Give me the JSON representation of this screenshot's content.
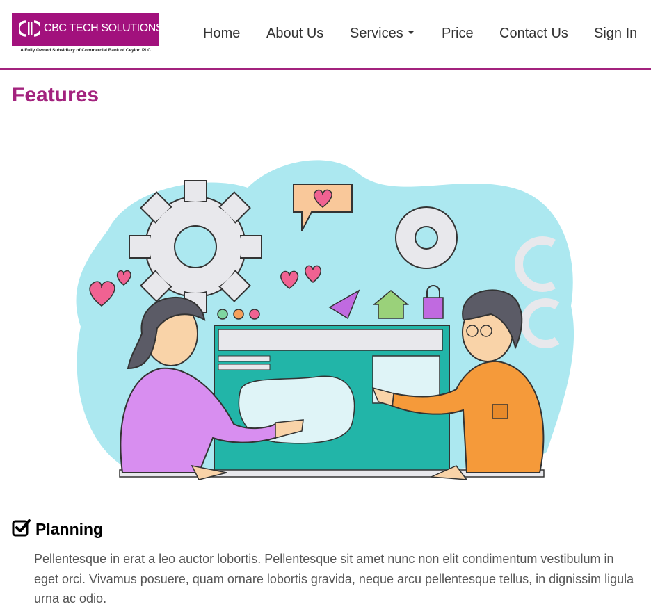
{
  "brand": {
    "name": "CBC TECH SOLUTIONS",
    "tagline": "A Fully Owned Subsidiary of Commercial Bank of Ceylon PLC",
    "color": "#a2117d"
  },
  "nav": {
    "home": "Home",
    "about": "About Us",
    "services": "Services",
    "price": "Price",
    "contact": "Contact Us",
    "signin": "Sign In"
  },
  "page": {
    "title": "Features",
    "accent_color": "#a3237e"
  },
  "feature": {
    "icon": "check-square-icon",
    "heading": "Planning",
    "text": "Pellentesque in erat a leo auctor lobortis. Pellentesque sit amet nunc non elit condimentum vestibulum in eget orci. Vivamus posuere, quam ornare lobortis gravida, neque arcu pellentesque tellus, in dignissim ligula urna ac odio."
  }
}
